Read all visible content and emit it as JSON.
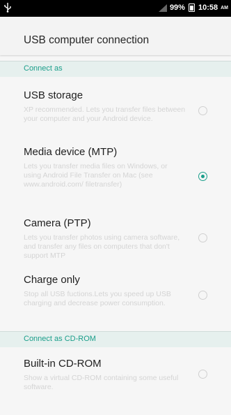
{
  "status_bar": {
    "usb_icon": "usb-icon",
    "battery": "99%",
    "time": "10:58",
    "ampm": "AM"
  },
  "title": "USB computer connection",
  "sections": {
    "connect_as": "Connect as",
    "connect_as_cdrom": "Connect as CD-ROM"
  },
  "options": [
    {
      "title": "USB storage",
      "desc": "XP recommended. Lets you transfer files between your computer and your Android device.",
      "selected": false
    },
    {
      "title": "Media device (MTP)",
      "desc": "Lets you transfer media files on Windows, or using Android File Transfer on Mac (see www.android.com/ filetransfer)",
      "selected": true
    },
    {
      "title": "Camera (PTP)",
      "desc": "Lets you transfer photos using camera software, and transfer any files on computers that don't support MTP",
      "selected": false
    },
    {
      "title": "Charge only",
      "desc": "Stop all USB fuctions.Lets you speed up USB charging and decrease power consumption.",
      "selected": false
    },
    {
      "title": "Built-in CD-ROM",
      "desc": "Show a virtual CD-ROM containing some useful software.",
      "selected": false
    }
  ],
  "colors": {
    "accent": "#1a9e8a"
  }
}
